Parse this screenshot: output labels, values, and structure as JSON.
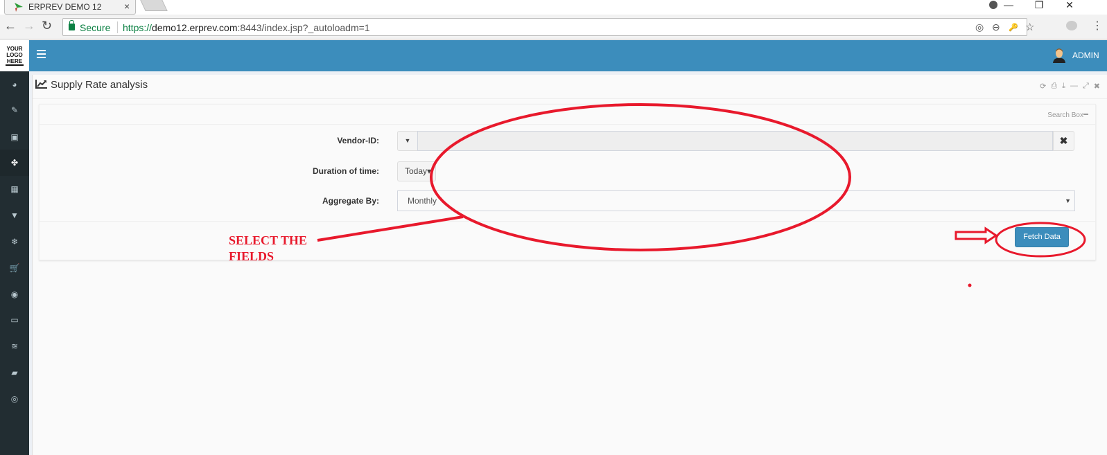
{
  "browser": {
    "tab_title": "ERPREV DEMO 12",
    "tab_close": "×",
    "secure_label": "Secure",
    "url_scheme": "https://",
    "url_host": "demo12.erprev.com",
    "url_rest": ":8443/index.jsp?_autoloadm=1",
    "window_controls": {
      "minimize": "—",
      "restore": "❐",
      "close": "✕"
    },
    "nav": {
      "back": "←",
      "forward": "→",
      "reload": "↻"
    },
    "omnibox_icons": {
      "location": "◎",
      "zoom": "⊖",
      "key": "🔑",
      "star": "☆"
    },
    "menu": "⋮"
  },
  "header": {
    "logo_lines": [
      "YOUR",
      "LOGO",
      "HERE"
    ],
    "user_label": "ADMIN",
    "accent_color": "#3c8dbc"
  },
  "sidebar": {
    "items": [
      {
        "icon": "dashboard-icon",
        "glyph": "◕",
        "active": false
      },
      {
        "icon": "ticket-icon",
        "glyph": "✎",
        "active": false
      },
      {
        "icon": "money-icon",
        "glyph": "▣",
        "active": false
      },
      {
        "icon": "cubes-icon",
        "glyph": "✤",
        "active": true
      },
      {
        "icon": "building-icon",
        "glyph": "▦",
        "active": false
      },
      {
        "icon": "trash-icon",
        "glyph": "▼",
        "active": false
      },
      {
        "icon": "snowflake-icon",
        "glyph": "❄",
        "active": false
      },
      {
        "icon": "cart-icon",
        "glyph": "🛒",
        "active": false
      },
      {
        "icon": "spotify-icon",
        "glyph": "◉",
        "active": false
      },
      {
        "icon": "desktop-icon",
        "glyph": "▭",
        "active": false
      },
      {
        "icon": "database-icon",
        "glyph": "≋",
        "active": false
      },
      {
        "icon": "book-icon",
        "glyph": "▰",
        "active": false
      },
      {
        "icon": "life-ring-icon",
        "glyph": "◎",
        "active": false
      }
    ]
  },
  "panel": {
    "title": "Supply Rate analysis",
    "tools": {
      "refresh": "⟳",
      "print": "⎙",
      "download": "⤓",
      "minimize": "—",
      "expand": "⤢",
      "close": "✖"
    },
    "search_box_label": "Search Box"
  },
  "form": {
    "vendor_label": "Vendor-ID:",
    "vendor_value": "",
    "vendor_caret": "▼",
    "vendor_clear": "✖",
    "duration_label": "Duration of time:",
    "duration_value": "Today",
    "duration_caret": "▾",
    "aggregate_label": "Aggregate By:",
    "aggregate_value": "Monthly",
    "aggregate_caret": "▼",
    "fetch_button": "Fetch Data"
  },
  "annotation": {
    "text_line1": "SELECT THE",
    "text_line2": "FIELDS",
    "color": "#e8192c"
  }
}
